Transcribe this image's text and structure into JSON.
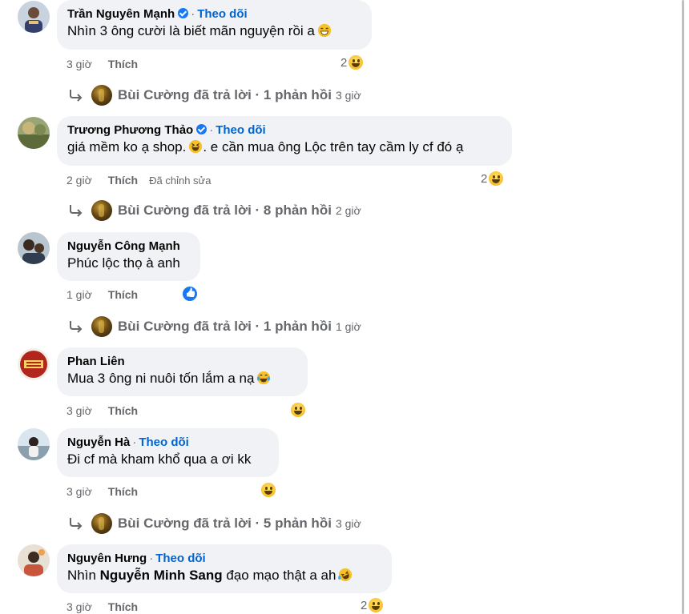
{
  "comments": [
    {
      "author": "Trần Nguyên Mạnh",
      "verified": true,
      "follow": "Theo dõi",
      "text": "Nhìn 3 ông cười là biết mãn nguyện rồi a",
      "time": "3 giờ",
      "like": "Thích",
      "reaction_count": "2",
      "reply": {
        "text": "Bùi Cường đã trả lời · 1 phản hồi",
        "time": "3 giờ"
      }
    },
    {
      "author": "Trương Phương Thảo",
      "verified": true,
      "follow": "Theo dõi",
      "text": "giá mềm ko ạ shop.",
      "text_after": ". e cần mua ông Lộc trên tay cầm ly cf đó ạ",
      "time": "2 giờ",
      "like": "Thích",
      "edited": "Đã chỉnh sửa",
      "reaction_count": "2",
      "reply": {
        "text": "Bùi Cường đã trả lời · 8 phản hồi",
        "time": "2 giờ"
      }
    },
    {
      "author": "Nguyễn Công Mạnh",
      "text": "Phúc lộc thọ à anh",
      "time": "1 giờ",
      "like": "Thích",
      "reply": {
        "text": "Bùi Cường đã trả lời · 1 phản hồi",
        "time": "1 giờ"
      }
    },
    {
      "author": "Phan Liên",
      "text": "Mua 3 ông ni nuôi tốn lắm a nạ",
      "time": "3 giờ",
      "like": "Thích"
    },
    {
      "author": "Nguyễn Hà",
      "follow": "Theo dõi",
      "text": "Đi cf mà kham khổ qua a ơi kk",
      "time": "3 giờ",
      "like": "Thích",
      "reply": {
        "text": "Bùi Cường đã trả lời · 5 phản hồi",
        "time": "3 giờ"
      }
    },
    {
      "author": "Nguyên Hưng",
      "follow": "Theo dõi",
      "text_before": "Nhìn",
      "mention": "Nguyễn Minh Sang",
      "text_after": "đạo mạo thật a ah",
      "time": "3 giờ",
      "like": "Thích",
      "reaction_count": "2"
    }
  ],
  "icons": {
    "reply_arrow": "reply-arrow-icon",
    "reaction_haha": "haha-reaction-icon",
    "reaction_like": "like-reaction-icon",
    "verified": "verified-badge-icon"
  },
  "colors": {
    "follow": "#0064d1",
    "bubble": "#f0f2f5",
    "meta": "#65676b",
    "verified": "#1877f2"
  }
}
